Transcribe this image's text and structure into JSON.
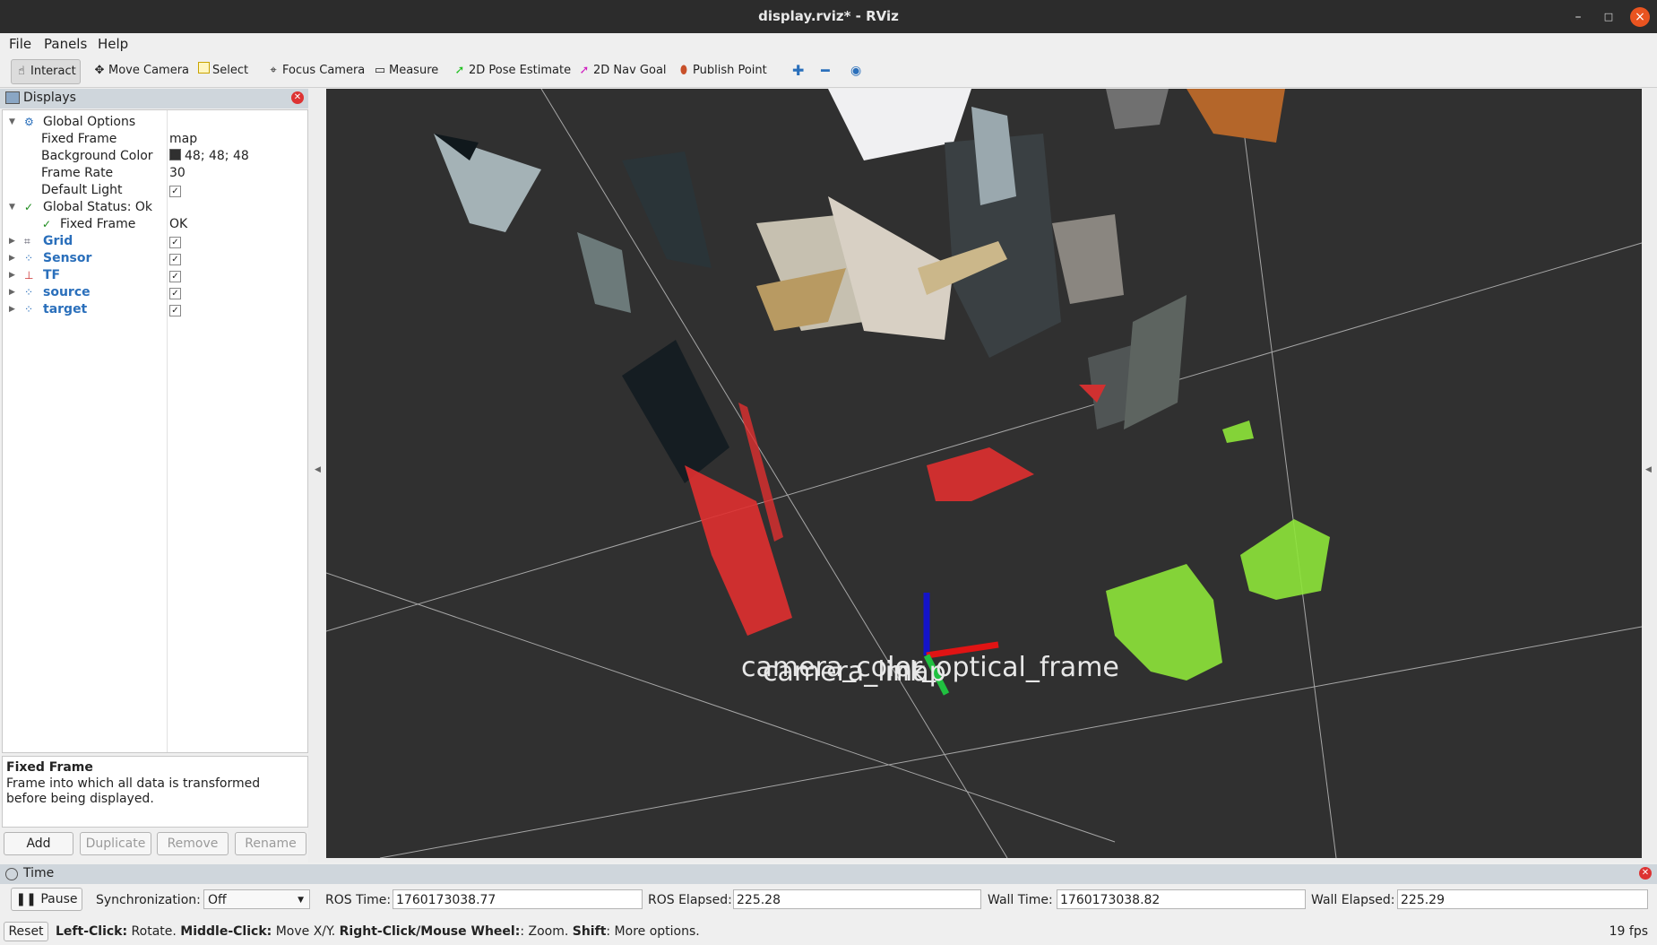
{
  "window": {
    "title": "display.rviz* - RViz",
    "controls": [
      "–",
      "□",
      "×"
    ]
  },
  "menu": [
    "File",
    "Panels",
    "Help"
  ],
  "toolbar": {
    "tools": [
      {
        "label": "Interact",
        "icon": "hand-icon"
      },
      {
        "label": "Move Camera",
        "icon": "move-camera-icon"
      },
      {
        "label": "Select",
        "icon": "select-icon"
      },
      {
        "label": "Focus Camera",
        "icon": "focus-camera-icon"
      },
      {
        "label": "Measure",
        "icon": "measure-icon"
      },
      {
        "label": "2D Pose Estimate",
        "icon": "pose-estimate-arrow-icon"
      },
      {
        "label": "2D Nav Goal",
        "icon": "nav-goal-arrow-icon"
      },
      {
        "label": "Publish Point",
        "icon": "map-pin-icon"
      }
    ],
    "active_tool": "Interact",
    "extra_icons": [
      "plus-icon",
      "minus-icon",
      "eye-icon"
    ]
  },
  "displays": {
    "title": "Displays",
    "global_options": {
      "label": "Global Options",
      "fixed_frame": {
        "label": "Fixed Frame",
        "value": "map"
      },
      "background_color": {
        "label": "Background Color",
        "value": "48; 48; 48",
        "color": "#303030"
      },
      "frame_rate": {
        "label": "Frame Rate",
        "value": "30"
      },
      "default_light": {
        "label": "Default Light",
        "checked": true
      }
    },
    "global_status": {
      "label": "Global Status: Ok",
      "fixed_frame": {
        "label": "Fixed Frame",
        "value": "OK"
      }
    },
    "items": [
      {
        "label": "Grid",
        "icon": "grid-icon",
        "checked": true
      },
      {
        "label": "Sensor",
        "icon": "pointcloud-icon",
        "checked": true
      },
      {
        "label": "TF",
        "icon": "tf-axes-icon",
        "checked": true
      },
      {
        "label": "source",
        "icon": "pointcloud-icon",
        "checked": true
      },
      {
        "label": "target",
        "icon": "pointcloud-icon",
        "checked": true
      }
    ],
    "description": {
      "title": "Fixed Frame",
      "body": "Frame into which all data is transformed before being displayed."
    },
    "buttons": {
      "add": "Add",
      "duplicate": "Duplicate",
      "remove": "Remove",
      "rename": "Rename"
    }
  },
  "viewport": {
    "background": "#303030",
    "frame_label": "camera_color_optical_frame",
    "overlapping_labels": [
      "camera_link",
      "map"
    ],
    "colors": {
      "source": "#e03030",
      "target": "#8ee63a",
      "x_axis": "#e01010",
      "y_axis": "#10c030",
      "z_axis": "#1010d0",
      "grid": "#a0a0a0"
    }
  },
  "time": {
    "title": "Time",
    "pause": "Pause",
    "sync_label": "Synchronization:",
    "sync_value": "Off",
    "ros_time_label": "ROS Time:",
    "ros_time": "1760173038.77",
    "ros_elapsed_label": "ROS Elapsed:",
    "ros_elapsed": "225.28",
    "wall_time_label": "Wall Time:",
    "wall_time": "1760173038.82",
    "wall_elapsed_label": "Wall Elapsed:",
    "wall_elapsed": "225.29"
  },
  "status": {
    "reset": "Reset",
    "hint_parts": [
      {
        "b": "Left-Click:",
        "t": " Rotate. "
      },
      {
        "b": "Middle-Click:",
        "t": " Move X/Y. "
      },
      {
        "b": "Right-Click/Mouse Wheel:",
        "t": ": Zoom. "
      },
      {
        "b": "Shift",
        "t": ": More options."
      }
    ],
    "fps": "19 fps"
  }
}
